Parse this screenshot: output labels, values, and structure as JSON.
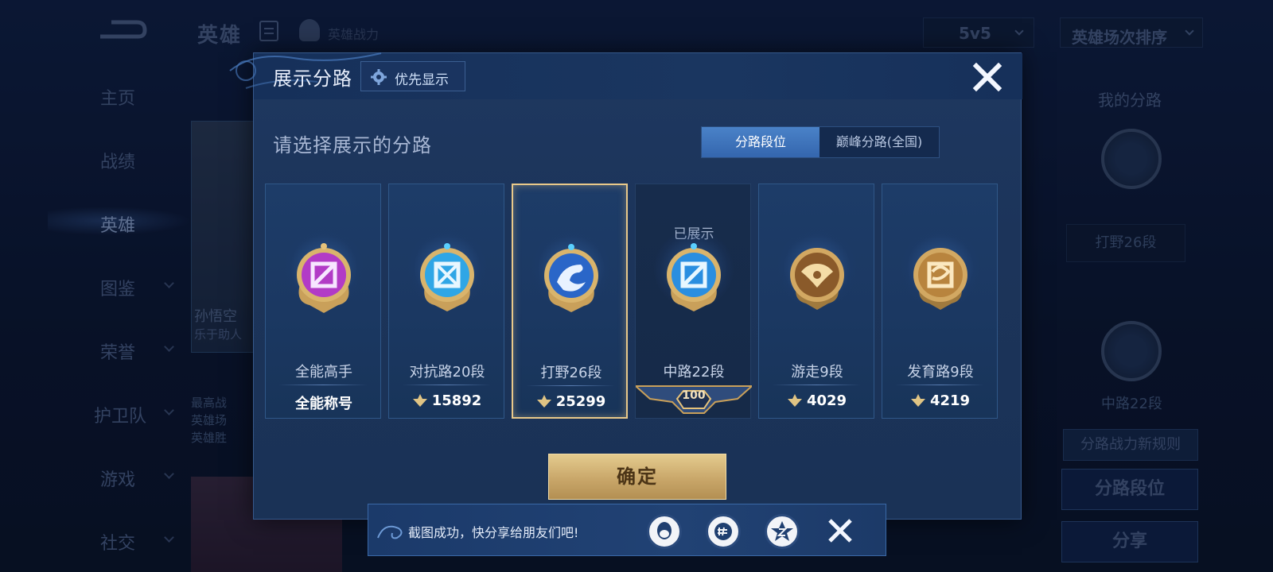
{
  "background": {
    "header_title": "英雄",
    "power_label": "英雄战力",
    "mode_select": "5v5",
    "sort_select": "英雄场次排序",
    "nav": [
      {
        "label": "主页"
      },
      {
        "label": "战绩"
      },
      {
        "label": "英雄"
      },
      {
        "label": "图鉴"
      },
      {
        "label": "荣誉"
      },
      {
        "label": "护卫队"
      },
      {
        "label": "游戏"
      },
      {
        "label": "社交"
      }
    ],
    "hero_name": "孙悟空",
    "hero_sub": "乐于助人",
    "hero_stats": [
      "最高战",
      "英雄场",
      "英雄胜"
    ],
    "my_lane_title": "我的分路",
    "my_lane_label": "打野26段",
    "shown_lane_label": "中路22段",
    "rule_button": "分路战力新规则",
    "lane_button": "分路段位",
    "share_button": "分享"
  },
  "modal": {
    "title": "展示分路",
    "priority_label": "优先显示",
    "prompt": "请选择展示的分路",
    "tabs": [
      {
        "label": "分路段位",
        "active": true
      },
      {
        "label": "巅峰分路(全国)",
        "active": false
      }
    ],
    "cards": [
      {
        "name": "全能高手",
        "value": "全能称号",
        "badge_icon": "all-round-badge-icon",
        "color": "#b23bc6",
        "state": "normal"
      },
      {
        "name": "对抗路20段",
        "value": "15892",
        "badge_icon": "clash-lane-badge-icon",
        "color": "#2fa6e6",
        "state": "normal"
      },
      {
        "name": "打野26段",
        "value": "25299",
        "badge_icon": "jungle-badge-icon",
        "color": "#2a66c8",
        "state": "selected"
      },
      {
        "name": "中路22段",
        "value": "100",
        "shown_tag": "已展示",
        "badge_icon": "mid-lane-badge-icon",
        "color": "#2a8ee0",
        "state": "disabled"
      },
      {
        "name": "游走9段",
        "value": "4029",
        "badge_icon": "roam-badge-icon",
        "color": "#c9a05a",
        "state": "normal"
      },
      {
        "name": "发育路9段",
        "value": "4219",
        "badge_icon": "farm-lane-badge-icon",
        "color": "#c9a05a",
        "state": "normal"
      }
    ],
    "confirm_label": "确定"
  },
  "toast": {
    "text": "截图成功，快分享给朋友们吧!",
    "buttons": [
      "qq-icon",
      "wechat-moments-icon",
      "qzone-icon"
    ]
  },
  "colors": {
    "accent_gold": "#e9c98a",
    "panel_blue": "#1c345a",
    "tab_active": "#3f74bb"
  }
}
